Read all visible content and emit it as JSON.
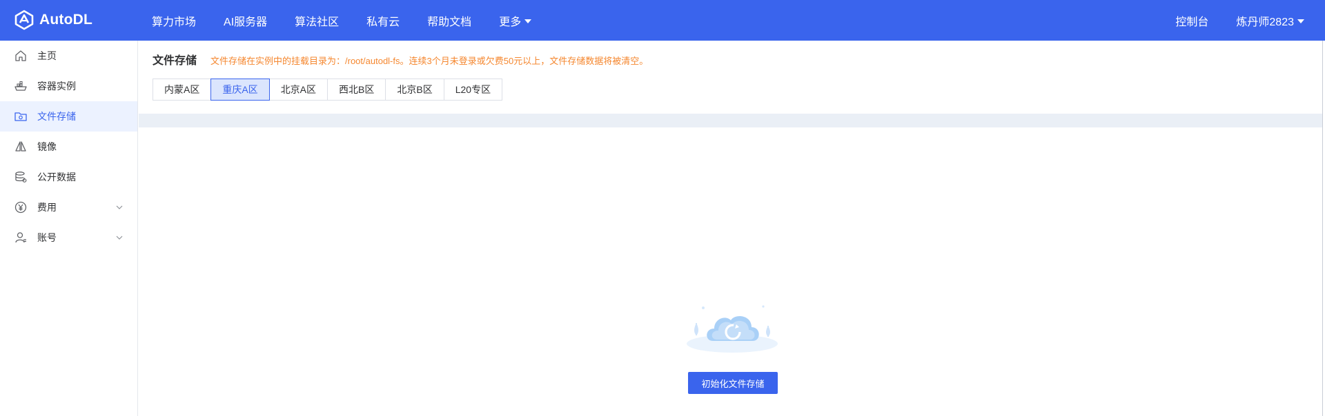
{
  "brand": {
    "name": "AutoDL"
  },
  "topnav": {
    "items": [
      "算力市场",
      "AI服务器",
      "算法社区",
      "私有云",
      "帮助文档"
    ],
    "more": "更多",
    "console": "控制台",
    "user": "炼丹师2823"
  },
  "sidebar": {
    "items": [
      {
        "label": "主页",
        "icon": "home-icon"
      },
      {
        "label": "容器实例",
        "icon": "container-icon"
      },
      {
        "label": "文件存储",
        "icon": "folder-gear-icon",
        "active": true
      },
      {
        "label": "镜像",
        "icon": "mirror-icon"
      },
      {
        "label": "公开数据",
        "icon": "database-icon"
      },
      {
        "label": "费用",
        "icon": "yen-icon",
        "expandable": true
      },
      {
        "label": "账号",
        "icon": "user-icon",
        "expandable": true
      }
    ]
  },
  "main": {
    "title": "文件存储",
    "notice": "文件存储在实例中的挂载目录为：/root/autodl-fs。连续3个月未登录或欠费50元以上，文件存储数据将被清空。",
    "tabs": [
      "内蒙A区",
      "重庆A区",
      "北京A区",
      "西北B区",
      "北京B区",
      "L20专区"
    ],
    "active_tab": "重庆A区",
    "init_button": "初始化文件存储"
  },
  "colors": {
    "primary": "#3a64ed",
    "notice": "#f5872f",
    "active_bg": "#ecf2ff"
  }
}
